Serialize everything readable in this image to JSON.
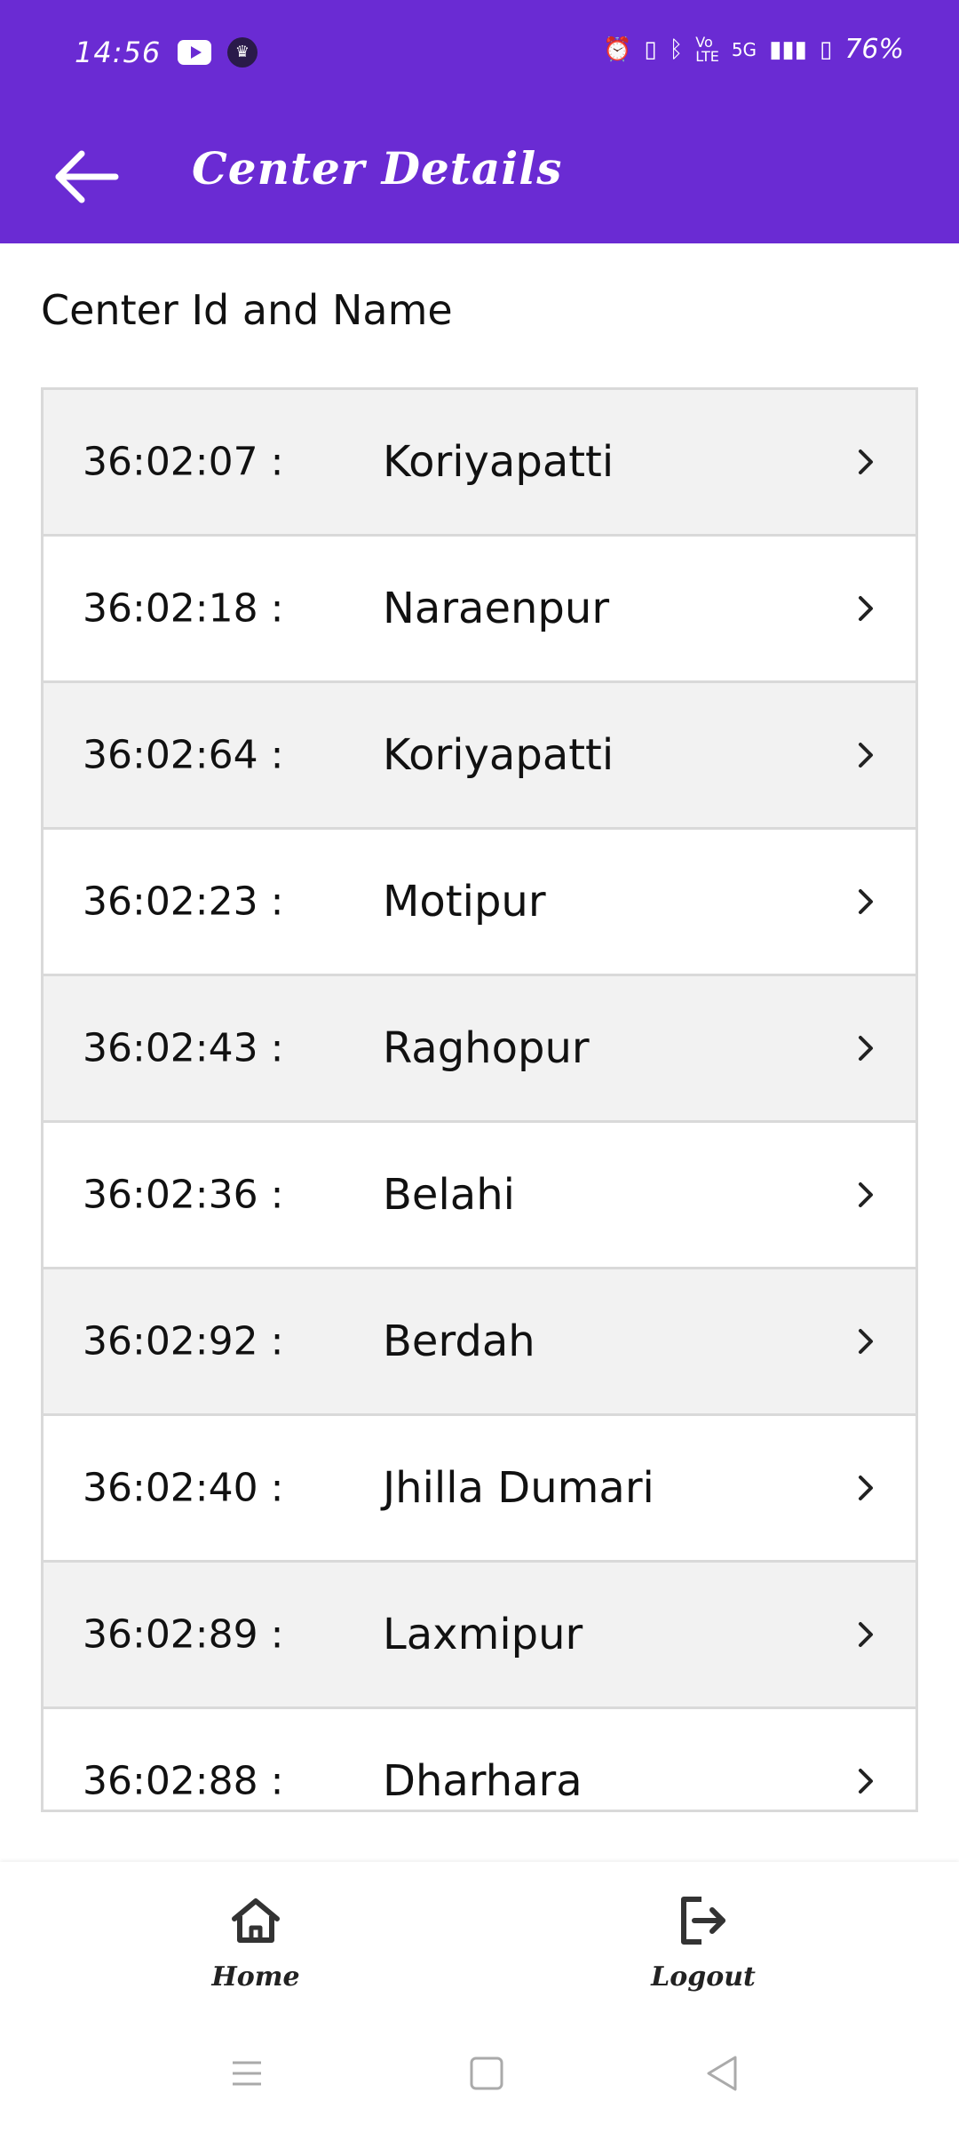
{
  "status_bar": {
    "time": "14:56",
    "battery": "76%",
    "network": "5G"
  },
  "app_bar": {
    "title": "Center Details",
    "back_icon": "arrow-left-icon"
  },
  "section": {
    "title": "Center Id and Name"
  },
  "centers": [
    {
      "id": "36:02:07 :",
      "name": "Koriyapatti"
    },
    {
      "id": "36:02:18  :",
      "name": "Naraenpur"
    },
    {
      "id": "36:02:64 :",
      "name": "Koriyapatti"
    },
    {
      "id": "36:02:23  :",
      "name": "Motipur"
    },
    {
      "id": "36:02:43 :",
      "name": "Raghopur"
    },
    {
      "id": "36:02:36 :",
      "name": "Belahi"
    },
    {
      "id": "36:02:92 :",
      "name": "Berdah"
    },
    {
      "id": "36:02:40 :",
      "name": "Jhilla Dumari"
    },
    {
      "id": "36:02:89 :",
      "name": "Laxmipur"
    },
    {
      "id": "36:02:88 :",
      "name": "Dharhara"
    }
  ],
  "bottom_nav": {
    "home_label": "Home",
    "logout_label": "Logout"
  },
  "colors": {
    "primary": "#6a2bd3",
    "row_alt": "#f2f2f2",
    "border": "#d9d9d9"
  }
}
